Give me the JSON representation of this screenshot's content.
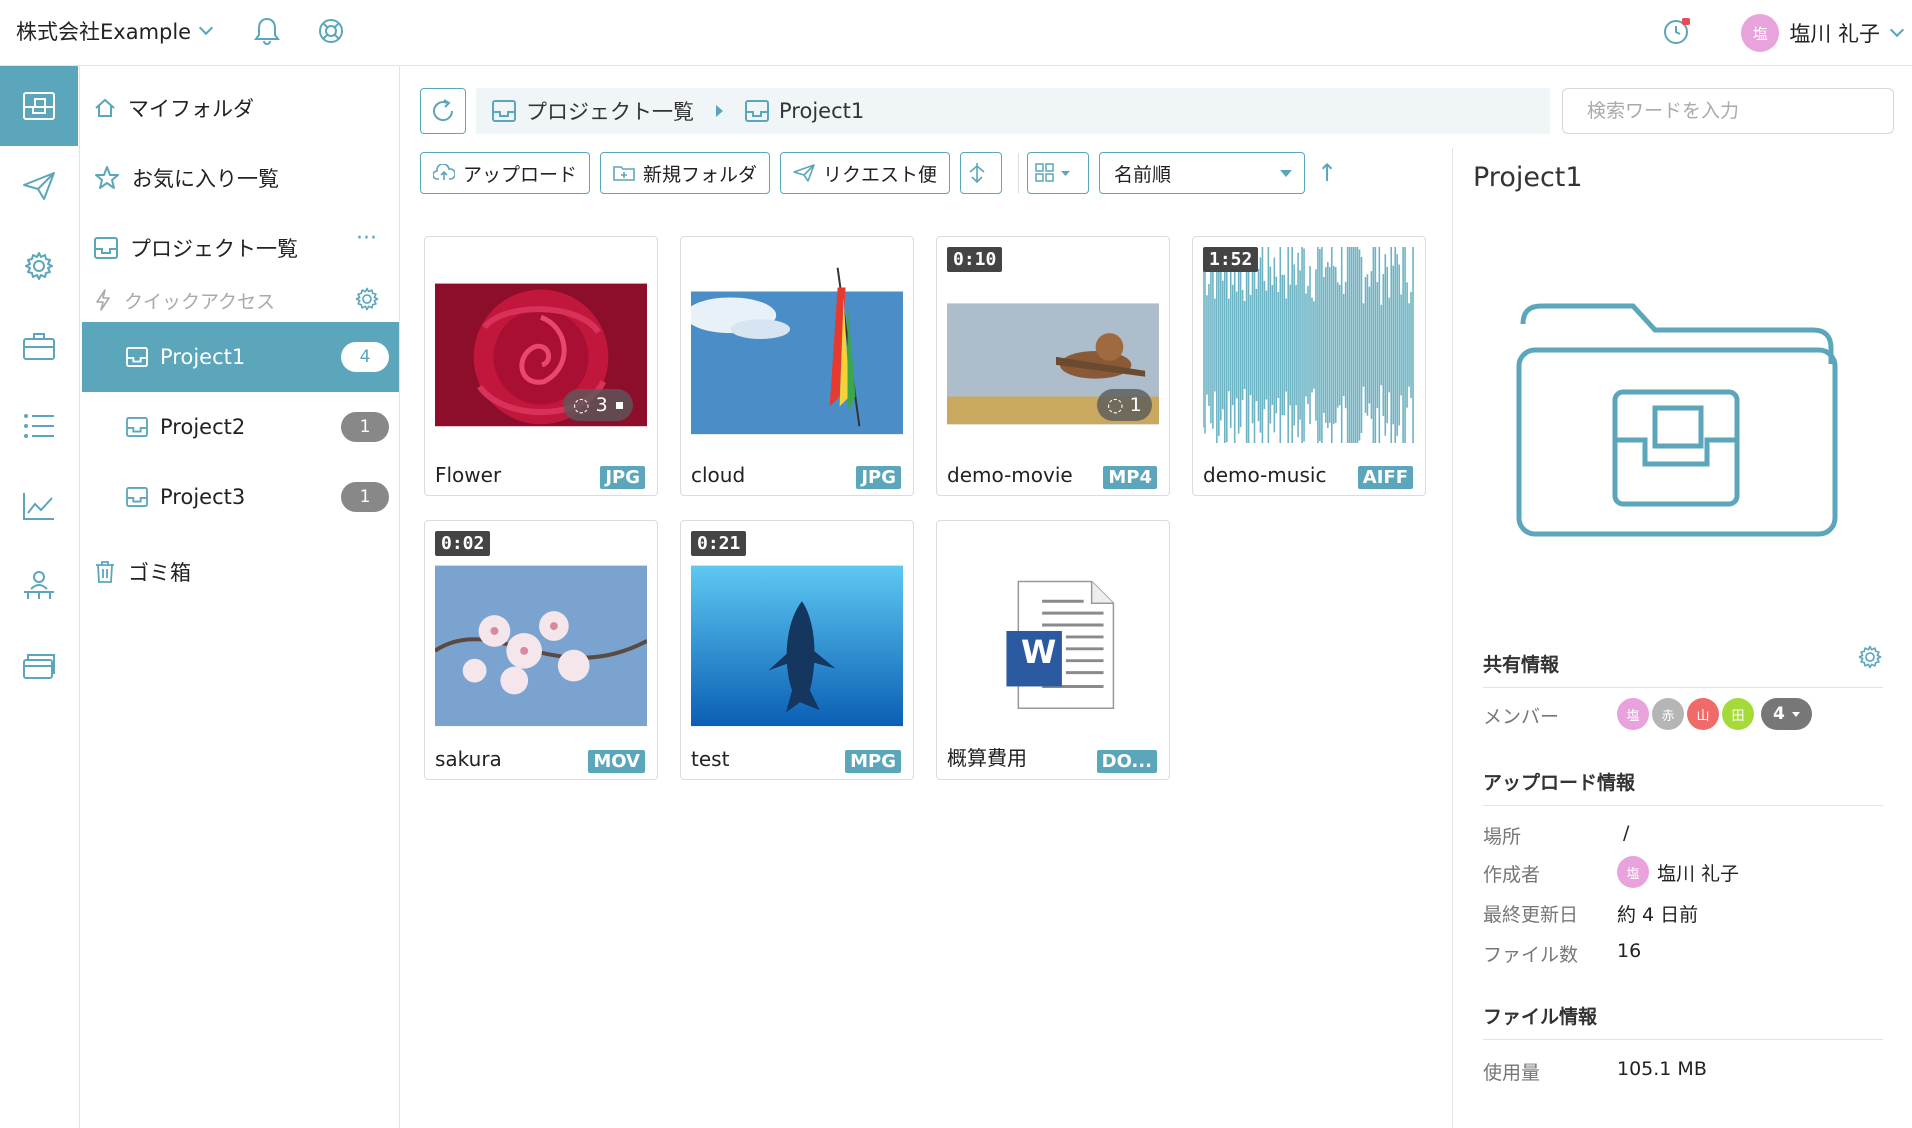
{
  "header": {
    "company": "株式会社Example",
    "user_initial": "塩",
    "user_name": "塩川 礼子"
  },
  "nav": {
    "my_folder": "マイフォルダ",
    "favorites": "お気に入り一覧",
    "project_list": "プロジェクト一覧",
    "more": "···",
    "quick_access": "クイックアクセス",
    "projects": [
      {
        "name": "Project1",
        "count": "4"
      },
      {
        "name": "Project2",
        "count": "1"
      },
      {
        "name": "Project3",
        "count": "1"
      }
    ],
    "trash": "ゴミ箱"
  },
  "breadcrumb": {
    "root": "プロジェクト一覧",
    "current": "Project1"
  },
  "search": {
    "placeholder": "検索ワードを入力"
  },
  "toolbar": {
    "upload": "アップロード",
    "new_folder": "新規フォルダ",
    "request": "リクエスト便",
    "sort": "名前順",
    "sort_dir": "↑"
  },
  "files": [
    {
      "name": "Flower",
      "type": "JPG",
      "comments": "3"
    },
    {
      "name": "cloud",
      "type": "JPG"
    },
    {
      "name": "demo-movie",
      "type": "MP4",
      "duration": "0:10",
      "comments": "1"
    },
    {
      "name": "demo-music",
      "type": "AIFF",
      "duration": "1:52"
    },
    {
      "name": "sakura",
      "type": "MOV",
      "duration": "0:02"
    },
    {
      "name": "test",
      "type": "MPG",
      "duration": "0:21"
    },
    {
      "name": "概算費用",
      "type": "DO...",
      "icon_letter": "W"
    }
  ],
  "detail": {
    "title": "Project1",
    "share_heading": "共有情報",
    "members_label": "メンバー",
    "members": [
      {
        "initial": "塩",
        "color": "#e8a2dc"
      },
      {
        "initial": "赤",
        "color": "#b5b5b5"
      },
      {
        "initial": "山",
        "color": "#f06a6a"
      },
      {
        "initial": "田",
        "color": "#a6d93a"
      }
    ],
    "members_more": "4",
    "upload_heading": "アップロード情報",
    "location_label": "場所",
    "location_value": "/",
    "creator_label": "作成者",
    "creator_initial": "塩",
    "creator_value": "塩川 礼子",
    "updated_label": "最終更新日",
    "updated_value": "約 4 日前",
    "filecount_label": "ファイル数",
    "filecount_value": "16",
    "file_heading": "ファイル情報",
    "usage_label": "使用量",
    "usage_value": "105.1 MB"
  },
  "colors": {
    "accent": "#5ba6ba"
  }
}
